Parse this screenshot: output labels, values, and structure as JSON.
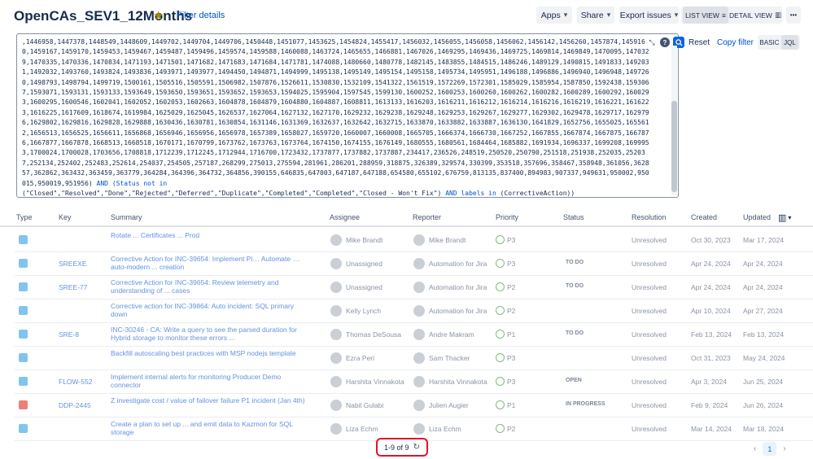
{
  "header": {
    "title": "OpenCAs_SEV1_12Months",
    "filter_details": "Filter details",
    "apps": "Apps",
    "share": "Share",
    "export": "Export issues",
    "list_view": "LIST VIEW",
    "detail_view": "DETAIL VIEW",
    "more": "•••"
  },
  "jql": {
    "query_ids": ",1446958,1447378,1448549,1448609,1449702,1449704,1449706,1450448,1451077,1453625,1454824,1455417,1456032,1456055,1456058,1456062,1456142,1456260,1457874,1459160,1459167,1459170,1459453,1459467,1459487,1459496,1459574,1459588,1460088,1463724,1465655,1466881,1467026,1469295,1469436,1469725,1469814,1469849,1470095,1470329,1470335,1470336,1470834,1471193,1471501,1471682,1471683,1471684,1471781,1474088,1480660,1480778,1482145,1483855,1484515,1486246,1489129,1490815,1491833,1492031,1492032,1493760,1493824,1493836,1493971,1493977,1494450,1494871,1494999,1495138,1495149,1495154,1495158,1495734,1495951,1496188,1496886,1496940,1496948,1497260,1498793,1498794,1499719,1500161,1505516,1505591,1506982,1507876,1526611,1530830,1532109,1541322,1561519,1572269,1572301,1585029,1585954,1587850,1592438,1593067,1593071,1593131,1593133,1593649,1593650,1593651,1593652,1593653,1594025,1595904,1597545,1599130,1600252,1600253,1600260,1600262,1600282,1600289,1600292,1600293,1600295,1600546,1602041,1602052,1602053,1602663,1604878,1604879,1604880,1604887,1608811,1613133,1616203,1616211,1616212,1616214,1616216,1616219,1616221,1616223,1616225,1617609,1618674,1619984,1625029,1625045,1626537,1627064,1627132,1627170,1629232,1629238,1629248,1629253,1629267,1629277,1629302,1629478,1629717,1629796,1629802,1629816,1629828,1629888,1630436,1630781,1630854,1631146,1631369,1632637,1632642,1632715,1633870,1633882,1633887,1636130,1641829,1652756,1655025,1655612,1656513,1656525,1656611,1656868,1656946,1656956,1656978,1657389,1658027,1659720,1660007,1660008,1665705,1666374,1666730,1667252,1667855,1667874,1667875,1667876,1667877,1667878,1668513,1668518,1670171,1670799,1673762,1673763,1673764,1674150,1674155,1676149,1680555,1680561,1684464,1685882,1691934,1696337,1699208,1699953,1700024,1700028,1703656,1708818,1712239,1712245,1712944,1716700,1723432,1737877,1737882,1737887,234417,236526,248519,250520,250790,251518,251938,252035,252037,252134,252402,252483,252614,254037,254505,257187,268299,275013,275594,281961,286201,288959,318875,326389,329574,330399,353518,357696,358467,358948,361056,362857,362862,363432,363459,363779,364284,364396,364732,364856,390155,646835,647003,647187,647188,654580,655102,676759,813135,837400,894983,907337,949631,950002,950015,950019,951956)",
    "query_and": "AND",
    "query_status_kw": "(Status not in",
    "query_status_vals": "(\"Closed\",\"Resolved\",\"Done\",\"Rejected\",\"Deferred\",\"Duplicate\",\"Completed\",\"Completed\",\"Closed - Won't Fix\")",
    "query_and2": "AND",
    "query_labels": "labels in",
    "query_label_val": "(CorrectiveAction))",
    "reset": "Reset",
    "copy_filter": "Copy filter",
    "basic": "BASIC",
    "jql": "JQL"
  },
  "table": {
    "headers": {
      "type": "Type",
      "key": "Key",
      "summary": "Summary",
      "assignee": "Assignee",
      "reporter": "Reporter",
      "priority": "Priority",
      "status": "Status",
      "resolution": "Resolution",
      "created": "Created",
      "updated": "Updated"
    },
    "rows": [
      {
        "key": "",
        "summary": "Rotate ... Certificates ... Prod",
        "assignee": "Mike Brandt",
        "reporter": "Mike Brandt",
        "priority": "P3",
        "status": "",
        "resolution": "Unresolved",
        "created": "Oct 30, 2023",
        "updated": "Mar 17, 2024"
      },
      {
        "key": "SREEXE",
        "summary": "Corrective Action for INC-39654: Implement Pi… Automate … auto-modern ... creation",
        "assignee": "Unassigned",
        "reporter": "Automation for Jira",
        "priority": "P3",
        "status": "TO DO",
        "resolution": "Unresolved",
        "created": "Apr 24, 2024",
        "updated": "Apr 24, 2024"
      },
      {
        "key": "SREE-77",
        "summary": "Corrective Action for INC-39654: Review telemetry and understanding of ... cases",
        "assignee": "Unassigned",
        "reporter": "Automation for Jira",
        "priority": "P2",
        "status": "TO DO",
        "resolution": "Unresolved",
        "created": "Apr 24, 2024",
        "updated": "Apr 24, 2024"
      },
      {
        "key": "",
        "summary": "Corrective action for INC-39864: Auto incident: SQL primary down",
        "assignee": "Kelly Lynch",
        "reporter": "Automation for Jira",
        "priority": "P2",
        "status": "",
        "resolution": "Unresolved",
        "created": "Apr 10, 2024",
        "updated": "Apr 27, 2024"
      },
      {
        "key": "SRE-8",
        "summary": "INC-30246 - CA: Write a query to see the parsed duration for Hybrid storage to monitor these errors ...",
        "assignee": "Thomas DeSousa",
        "reporter": "Andre Makram",
        "priority": "P1",
        "status": "TO DO",
        "resolution": "Unresolved",
        "created": "Feb 13, 2024",
        "updated": "Feb 13, 2024"
      },
      {
        "key": "",
        "summary": "Backfill autoscaling best practices with MSP nodejs template",
        "assignee": "Ezra Peri",
        "reporter": "Sam Thacker",
        "priority": "P3",
        "status": "",
        "resolution": "Unresolved",
        "created": "Oct 31, 2023",
        "updated": "May 24, 2024"
      },
      {
        "key": "FLOW-552",
        "summary": "Implement internal alerts for monitoring Producer Demo connector",
        "assignee": "Harshita Vinnakota",
        "reporter": "Harshita Vinnakota",
        "priority": "P3",
        "status": "OPEN",
        "resolution": "Unresolved",
        "created": "Apr 3, 2024",
        "updated": "Jun 25, 2024"
      },
      {
        "key": "DDP-2445",
        "summary": "Z investigate cost / value of failover failure P1 incident (Jan 4th)",
        "assignee": "Nabil Gulabi",
        "reporter": "Julien Augier",
        "priority": "P1",
        "status": "IN PROGRESS",
        "resolution": "Unresolved",
        "created": "Feb 9, 2024",
        "updated": "Jun 26, 2024"
      },
      {
        "key": "",
        "summary": "Create a plan to set up ... and emit data to Kazmon for SQL storage",
        "assignee": "Liza Echm",
        "reporter": "Liza Echm",
        "priority": "P2",
        "status": "",
        "resolution": "Unresolved",
        "created": "Mar 14, 2024",
        "updated": "Mar 18, 2024"
      }
    ]
  },
  "footer": {
    "counter": "1-9 of 9",
    "page": "1"
  },
  "colors": {
    "accent": "#0c66e4",
    "link": "#0052cc",
    "highlight": "#e2132a"
  }
}
